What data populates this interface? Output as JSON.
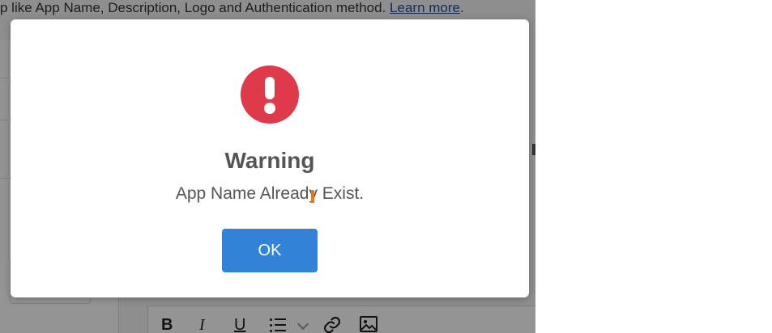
{
  "background": {
    "intro_text": "p like App Name, Description, Logo and Authentication method.",
    "learn_more_link": "Learn more",
    "intro_suffix": ".",
    "editor_toolbar": {
      "bold_label": "B",
      "italic_label": "I",
      "underline_label": "U"
    }
  },
  "dialog": {
    "icon": "exclamation-circle-icon",
    "title": "Warning",
    "message": "App Name Already Exist.",
    "ok_label": "OK",
    "colors": {
      "icon_bg": "#e0394a",
      "button_bg": "#3283d7"
    }
  }
}
